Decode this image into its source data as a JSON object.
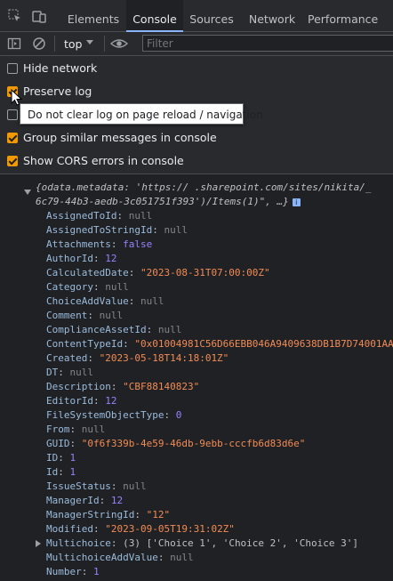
{
  "tabs": [
    {
      "label": "Elements"
    },
    {
      "label": "Console"
    },
    {
      "label": "Sources"
    },
    {
      "label": "Network"
    },
    {
      "label": "Performance"
    }
  ],
  "active_tab": "Console",
  "toolbar": {
    "context": "top",
    "filter_placeholder": "Filter"
  },
  "settings": [
    {
      "label": "Hide network",
      "checked": false
    },
    {
      "label": "Preserve log",
      "checked": true
    },
    {
      "label": "",
      "checked": false
    },
    {
      "label": "Group similar messages in console",
      "checked": true
    },
    {
      "label": "Show CORS errors in console",
      "checked": true
    }
  ],
  "tooltip": "Do not clear log on page reload / navigation",
  "object": {
    "header_line1": "{odata.metadata: 'https://      .sharepoint.com/sites/nikita/_",
    "header_line2": "6c79-44b3-aedb-3c051751f393')/Items(1)\", …}",
    "properties": [
      {
        "key": "AssignedToId",
        "value": "null",
        "type": "null"
      },
      {
        "key": "AssignedToStringId",
        "value": "null",
        "type": "null"
      },
      {
        "key": "Attachments",
        "value": "false",
        "type": "bool"
      },
      {
        "key": "AuthorId",
        "value": "12",
        "type": "num"
      },
      {
        "key": "CalculatedDate",
        "value": "\"2023-08-31T07:00:00Z\"",
        "type": "str"
      },
      {
        "key": "Category",
        "value": "null",
        "type": "null"
      },
      {
        "key": "ChoiceAddValue",
        "value": "null",
        "type": "null"
      },
      {
        "key": "Comment",
        "value": "null",
        "type": "null"
      },
      {
        "key": "ComplianceAssetId",
        "value": "null",
        "type": "null"
      },
      {
        "key": "ContentTypeId",
        "value": "\"0x01004981C56D66EBB046A9409638DB1B7D74001AA",
        "type": "str"
      },
      {
        "key": "Created",
        "value": "\"2023-05-18T14:18:01Z\"",
        "type": "str"
      },
      {
        "key": "DT",
        "value": "null",
        "type": "null"
      },
      {
        "key": "Description",
        "value": "\"CBF88140823\"",
        "type": "str"
      },
      {
        "key": "EditorId",
        "value": "12",
        "type": "num"
      },
      {
        "key": "FileSystemObjectType",
        "value": "0",
        "type": "num"
      },
      {
        "key": "From",
        "value": "null",
        "type": "null"
      },
      {
        "key": "GUID",
        "value": "\"0f6f339b-4e59-46db-9ebb-cccfb6d83d6e\"",
        "type": "str"
      },
      {
        "key": "ID",
        "value": "1",
        "type": "num"
      },
      {
        "key": "Id",
        "value": "1",
        "type": "num"
      },
      {
        "key": "IssueStatus",
        "value": "null",
        "type": "null"
      },
      {
        "key": "ManagerId",
        "value": "12",
        "type": "num"
      },
      {
        "key": "ManagerStringId",
        "value": "\"12\"",
        "type": "str"
      },
      {
        "key": "Modified",
        "value": "\"2023-09-05T19:31:02Z\"",
        "type": "str"
      },
      {
        "key": "Multichoice",
        "value": "(3) ['Choice 1', 'Choice 2', 'Choice 3']",
        "type": "array"
      },
      {
        "key": "MultichoiceAddValue",
        "value": "null",
        "type": "null"
      },
      {
        "key": "Number",
        "value": "1",
        "type": "num"
      }
    ]
  },
  "colors": {
    "accent": "#8ab4f8",
    "checkbox": "#f29900"
  }
}
